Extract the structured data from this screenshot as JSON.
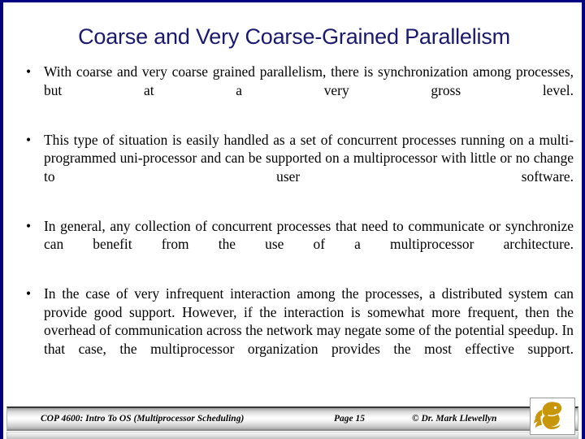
{
  "slide": {
    "title": "Coarse and Very Coarse-Grained Parallelism",
    "title_color": "#191970",
    "border_color": "#000080",
    "background_color": "#FFFFFF",
    "bullet_marker": "•",
    "bullets": [
      "With coarse and very coarse grained parallelism, there is synchronization among processes, but at a very gross level.",
      "This type of situation is easily handled as a set of concurrent processes running on a multi-programmed uni-processor and can be supported on a multiprocessor with little or no change to user software.",
      "In general, any collection of concurrent processes that need to communicate or synchronize can benefit from the use of a multiprocessor architecture.",
      "In the case of very infrequent interaction among the processes, a distributed system can provide good support.  However, if the interaction is somewhat more frequent, then the overhead of communication across the network may negate some of the potential speedup.  In that case, the multiprocessor organization provides the most effective support."
    ]
  },
  "footer": {
    "course": "COP 4600: Intro To OS  (Multiprocessor Scheduling)",
    "page": "Page 15",
    "copyright": "© Dr. Mark Llewellyn",
    "logo_name": "ucf-pegasus-logo",
    "logo_color": "#C8960A"
  }
}
